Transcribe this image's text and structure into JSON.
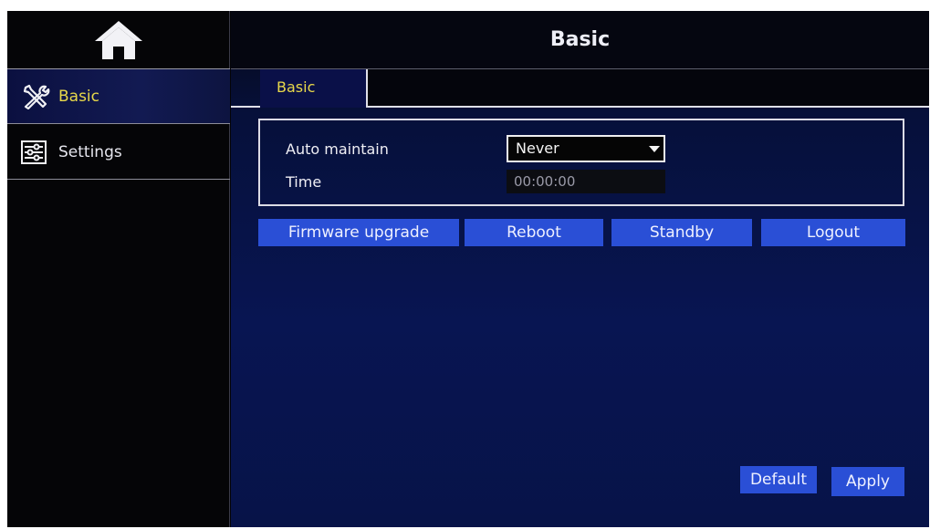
{
  "header": {
    "title": "Basic"
  },
  "sidebar": {
    "home_icon": "home-icon",
    "items": [
      {
        "label": "Basic",
        "icon": "tools-icon",
        "active": true
      },
      {
        "label": "Settings",
        "icon": "sliders-icon",
        "active": false
      }
    ]
  },
  "tabs": [
    {
      "label": "Basic",
      "active": true
    }
  ],
  "form": {
    "auto_maintain": {
      "label": "Auto maintain",
      "value": "Never"
    },
    "time": {
      "label": "Time",
      "value": "00:00:00"
    }
  },
  "actions": {
    "firmware_upgrade": "Firmware upgrade",
    "reboot": "Reboot",
    "standby": "Standby",
    "logout": "Logout"
  },
  "footer": {
    "default": "Default",
    "apply": "Apply"
  },
  "colors": {
    "accent_text": "#e8d84a",
    "button_blue": "#2a4fd6",
    "panel_navy": "#081552"
  }
}
